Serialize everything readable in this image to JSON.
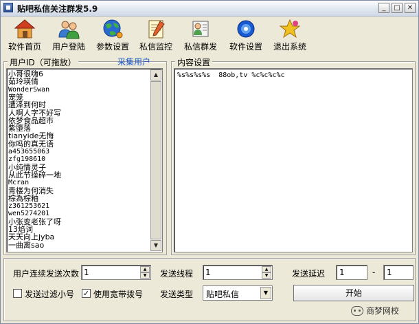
{
  "window": {
    "title": "贴吧私信关注群发5.9",
    "controls": {
      "minimize": "_",
      "maximize": "□",
      "close": "✕"
    }
  },
  "toolbar": {
    "items": [
      {
        "label": "软件首页",
        "icon": "home-icon"
      },
      {
        "label": "用户登陆",
        "icon": "users-icon"
      },
      {
        "label": "参数设置",
        "icon": "globe-icon"
      },
      {
        "label": "私信监控",
        "icon": "notepad-icon"
      },
      {
        "label": "私信群发",
        "icon": "message-icon"
      },
      {
        "label": "软件设置",
        "icon": "gear-icon"
      },
      {
        "label": "退出系统",
        "icon": "star-icon"
      }
    ]
  },
  "user_panel": {
    "legend": "用户ID（可拖放）",
    "collect_link": "采集用户",
    "users": [
      "小哥很嗨6",
      "茹玲瑛倩",
      "WonderSwan",
      "宠笼",
      "遭泽到何时",
      "人啊人字不好写",
      "依梦食品超市",
      "紫墮落",
      "tianyide无悔",
      "你吗的真无语",
      "a453655063",
      "zfg198610",
      "小纯情灵子",
      "从此节操碎一地",
      "Mcran",
      "青楼为何消失",
      "棕為棕釉",
      "z361253621",
      "wen5274201",
      "小张变老张了呀",
      "13焰词",
      "天天向上jyba",
      "一曲离sao"
    ]
  },
  "content_panel": {
    "legend": "内容设置",
    "text": "%s%s%s%s  88ob,tv %c%c%c%c"
  },
  "settings": {
    "consecutive_label": "用户连续发送次数",
    "consecutive_value": "1",
    "threads_label": "发送线程",
    "threads_value": "1",
    "delay_label": "发送延迟",
    "delay_min": "1",
    "delay_dash": "-",
    "delay_max": "1",
    "filter_label": "发送过滤小号",
    "filter_checked": false,
    "broadband_label": "使用宽带拨号",
    "broadband_checked": true,
    "type_label": "发送类型",
    "type_value": "贴吧私信",
    "start_label": "开始",
    "check_mark": "✓"
  },
  "watermark": {
    "text": "商梦网校"
  }
}
